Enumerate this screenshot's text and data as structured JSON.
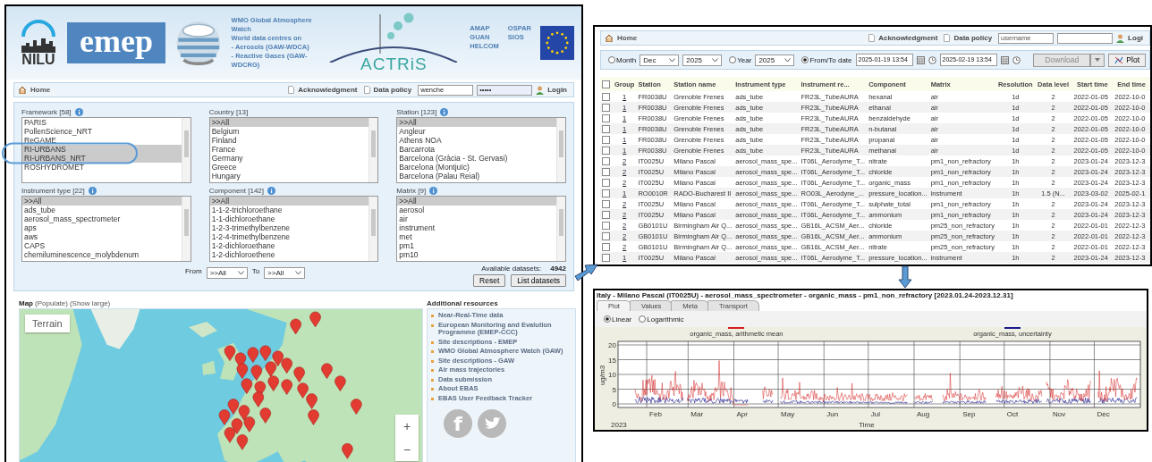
{
  "header": {
    "nilu": "NILU",
    "emep": "emep",
    "wmo_lines": [
      "WMO Global Atmosphere Watch",
      "World data centres on",
      "- Aerosols (GAW-WDCA)",
      "- Reactive Gases (GAW-WDCRG)"
    ],
    "actris": "ACTRiS",
    "partners": [
      "AMAP",
      "OSPAR",
      "GUAN",
      "SIOS",
      "HELCOM"
    ]
  },
  "search_nav": {
    "home": "Home",
    "links": [
      "Acknowledgment",
      "Data policy"
    ],
    "username": "wenche",
    "password": "•••••",
    "login": "Login"
  },
  "filters": {
    "lists": [
      {
        "label": "Framework [58]",
        "info": true,
        "items": [
          {
            "label": "PARIS",
            "selected": false
          },
          {
            "label": "PollenScience_NRT",
            "selected": false
          },
          {
            "label": "ReGAME",
            "selected": false
          },
          {
            "label": "RI-URBANS",
            "selected": true
          },
          {
            "label": "RI-URBANS_NRT",
            "selected": true
          },
          {
            "label": "ROSHYDROMET",
            "selected": false
          }
        ]
      },
      {
        "label": "Country [13]",
        "info": false,
        "items": [
          {
            "label": ">>All",
            "selected": true
          },
          {
            "label": "Belgium",
            "selected": false
          },
          {
            "label": "Finland",
            "selected": false
          },
          {
            "label": "France",
            "selected": false
          },
          {
            "label": "Germany",
            "selected": false
          },
          {
            "label": "Greece",
            "selected": false
          },
          {
            "label": "Hungary",
            "selected": false
          }
        ]
      },
      {
        "label": "Station [123]",
        "info": true,
        "items": [
          {
            "label": ">>All",
            "selected": true
          },
          {
            "label": "Angleur",
            "selected": false
          },
          {
            "label": "Athens NOA",
            "selected": false
          },
          {
            "label": "Barcarrota",
            "selected": false
          },
          {
            "label": "Barcelona (Gràcia - St. Gervasi)",
            "selected": false
          },
          {
            "label": "Barcelona (Montjuïc)",
            "selected": false
          },
          {
            "label": "Barcelona (Palau Reial)",
            "selected": false
          }
        ]
      },
      {
        "label": "Instrument type [22]",
        "info": true,
        "items": [
          {
            "label": ">>All",
            "selected": true
          },
          {
            "label": "ads_tube",
            "selected": false
          },
          {
            "label": "aerosol_mass_spectrometer",
            "selected": false
          },
          {
            "label": "aps",
            "selected": false
          },
          {
            "label": "aws",
            "selected": false
          },
          {
            "label": "CAPS",
            "selected": false
          },
          {
            "label": "chemiluminescence_molybdenum",
            "selected": false
          }
        ]
      },
      {
        "label": "Component [142]",
        "info": true,
        "items": [
          {
            "label": ">>All",
            "selected": true
          },
          {
            "label": "1-1-2-trichloroethane",
            "selected": false
          },
          {
            "label": "1-1-dichloroethane",
            "selected": false
          },
          {
            "label": "1-2-3-trimethylbenzene",
            "selected": false
          },
          {
            "label": "1-2-4-trimethylbenzene",
            "selected": false
          },
          {
            "label": "1-2-dichloroethane",
            "selected": false
          },
          {
            "label": "1-2-dichloroethene",
            "selected": false
          }
        ]
      },
      {
        "label": "Matrix [9]",
        "info": true,
        "items": [
          {
            "label": ">>All",
            "selected": true
          },
          {
            "label": "aerosol",
            "selected": false
          },
          {
            "label": "air",
            "selected": false
          },
          {
            "label": "instrument",
            "selected": false
          },
          {
            "label": "met",
            "selected": false
          },
          {
            "label": "pm1",
            "selected": false
          },
          {
            "label": "pm10",
            "selected": false
          }
        ]
      }
    ],
    "from": {
      "label": "From",
      "value": ">>All"
    },
    "to": {
      "label": "To",
      "value": ">>All"
    },
    "available_label": "Available datasets:",
    "available_count": "4942",
    "buttons": [
      "Reset",
      "List datasets"
    ]
  },
  "map": {
    "title": "Map",
    "links": [
      "(Populate)",
      "(Show large)"
    ],
    "terrain": "Terrain",
    "zoom": [
      "+",
      "−"
    ]
  },
  "resources": {
    "title": "Additional resources",
    "items": [
      "Near-Real-Time data",
      "European Monitoring and Evalution Programme (EMEP-CCC)",
      "Site descriptions - EMEP",
      "WMO Global Atmosphere Watch (GAW)",
      "Site descriptions - GAW",
      "Air mass trajectories",
      "Data submission",
      "About EBAS",
      "EBAS User Feedback Tracker"
    ],
    "facebook": "f"
  },
  "results_nav": {
    "home": "Home",
    "links": [
      "Acknowledgment",
      "Data policy"
    ],
    "username": "username",
    "login": "Logi"
  },
  "toolbar": {
    "month": {
      "label": "Month",
      "selected": false,
      "month": "Dec",
      "year": "2025"
    },
    "year": {
      "label": "Year",
      "selected": false,
      "value": "2025"
    },
    "range": {
      "label": "From/To date",
      "selected": true,
      "from": "2025-01-19 13:54",
      "to": "2025-02-19 13:54"
    },
    "download": {
      "label": "Download",
      "disabled": true
    },
    "plot": "Plot"
  },
  "table": {
    "all_checked": false,
    "columns": [
      "Group",
      "Station",
      "Station name",
      "Instrument type",
      "Instrument re...",
      "Component",
      "Matrix",
      "Resolution",
      "Data level",
      "Start time",
      "End time"
    ],
    "rows": [
      {
        "checked": false,
        "cells": [
          "1",
          "FR0038U",
          "Grenoble Frenes",
          "ads_tube",
          "FR23L_TubeAURA",
          "hexanal",
          "air",
          "1d",
          "2",
          "2022-01-05",
          "2022-10-0"
        ]
      },
      {
        "checked": false,
        "cells": [
          "1",
          "FR0038U",
          "Grenoble Frenes",
          "ads_tube",
          "FR23L_TubeAURA",
          "ethanal",
          "air",
          "1d",
          "2",
          "2022-01-05",
          "2022-10-0"
        ]
      },
      {
        "checked": false,
        "cells": [
          "1",
          "FR0038U",
          "Grenoble Frenes",
          "ads_tube",
          "FR23L_TubeAURA",
          "benzaldehyde",
          "air",
          "1d",
          "2",
          "2022-01-05",
          "2022-10-0"
        ]
      },
      {
        "checked": false,
        "cells": [
          "1",
          "FR0038U",
          "Grenoble Frenes",
          "ads_tube",
          "FR23L_TubeAURA",
          "n-butanal",
          "air",
          "1d",
          "2",
          "2022-01-05",
          "2022-10-0"
        ]
      },
      {
        "checked": false,
        "cells": [
          "1",
          "FR0038U",
          "Grenoble Frenes",
          "ads_tube",
          "FR23L_TubeAURA",
          "propanal",
          "air",
          "1d",
          "2",
          "2022-01-05",
          "2022-10-0"
        ]
      },
      {
        "checked": false,
        "cells": [
          "1",
          "FR0038U",
          "Grenoble Frenes",
          "ads_tube",
          "FR23L_TubeAURA",
          "methanal",
          "air",
          "1d",
          "2",
          "2022-01-05",
          "2022-10-0"
        ]
      },
      {
        "checked": false,
        "cells": [
          "2",
          "IT0025U",
          "Milano Pascal",
          "aerosol_mass_spe...",
          "IT06L_Aerodyme_T...",
          "nitrate",
          "pm1_non_refractory",
          "1h",
          "2",
          "2023-01-24",
          "2023-12-3"
        ]
      },
      {
        "checked": false,
        "cells": [
          "2",
          "IT0025U",
          "Milano Pascal",
          "aerosol_mass_spe...",
          "IT06L_Aerodyme_T...",
          "chloride",
          "pm1_non_refractory",
          "1h",
          "2",
          "2023-01-24",
          "2023-12-3"
        ]
      },
      {
        "checked": false,
        "cells": [
          "2",
          "IT0025U",
          "Milano Pascal",
          "aerosol_mass_spe...",
          "IT06L_Aerodyme_T...",
          "organic_mass",
          "pm1_non_refractory",
          "1h",
          "2",
          "2023-01-24",
          "2023-12-3"
        ]
      },
      {
        "checked": false,
        "cells": [
          "1",
          "RO0010R",
          "RADO-Bucharest II",
          "aerosol_mass_spe...",
          "RO03L_Aerodyne_...",
          "pressure_location...",
          "instrument",
          "1h",
          "1.5 (N...",
          "2023-03-02",
          "2025-02-1"
        ]
      },
      {
        "checked": false,
        "cells": [
          "2",
          "IT0025U",
          "Milano Pascal",
          "aerosol_mass_spe...",
          "IT06L_Aerodyme_T...",
          "sulphate_total",
          "pm1_non_refractory",
          "1h",
          "2",
          "2023-01-24",
          "2023-12-3"
        ]
      },
      {
        "checked": false,
        "cells": [
          "2",
          "IT0025U",
          "Milano Pascal",
          "aerosol_mass_spe...",
          "IT06L_Aerodyme_T...",
          "ammonium",
          "pm1_non_refractory",
          "1h",
          "2",
          "2023-01-24",
          "2023-12-3"
        ]
      },
      {
        "checked": false,
        "cells": [
          "2",
          "GB0101U",
          "Birmingham Air Q...",
          "aerosol_mass_spe...",
          "GB16L_ACSM_Aer...",
          "chloride",
          "pm25_non_refractory",
          "1h",
          "2",
          "2022-01-01",
          "2022-12-3"
        ]
      },
      {
        "checked": false,
        "cells": [
          "2",
          "GB0101U",
          "Birmingham Air Q...",
          "aerosol_mass_spe...",
          "GB16L_ACSM_Aer...",
          "ammonium",
          "pm25_non_refractory",
          "1h",
          "2",
          "2022-01-01",
          "2022-12-3"
        ]
      },
      {
        "checked": false,
        "cells": [
          "2",
          "GB0101U",
          "Birmingham Air Q...",
          "aerosol_mass_spe...",
          "GB16L_ACSM_Aer...",
          "nitrate",
          "pm25_non_refractory",
          "1h",
          "2",
          "2022-01-01",
          "2022-12-3"
        ]
      },
      {
        "checked": false,
        "cells": [
          "1",
          "IT0025U",
          "Milano Pascal",
          "aerosol_mass_spe...",
          "IT06L_Aerodyme_T...",
          "pressure_location...",
          "instrument",
          "1h",
          "2",
          "2023-01-24",
          "2023-12-3"
        ]
      }
    ]
  },
  "plot_panel": {
    "title": "Italy - Milano Pascal (IT0025U) - aerosol_mass_spectrometer - organic_mass - pm1_non_refractory [2023.01.24-2023.12.31]",
    "tabs": [
      {
        "label": "Plot",
        "selected": true
      },
      {
        "label": "Values",
        "selected": false
      },
      {
        "label": "Meta",
        "selected": false
      },
      {
        "label": "Transport",
        "selected": false
      }
    ],
    "scales": [
      {
        "label": "Linear",
        "selected": true
      },
      {
        "label": "Logarithmic",
        "selected": false
      }
    ],
    "legend": [
      {
        "label": "organic_mass, arithmetic mean",
        "color": "#d42020"
      },
      {
        "label": "organic_mass, uncertainty",
        "color": "#1a1a8c"
      }
    ],
    "y_ticks": [
      "20",
      "15",
      "10",
      "5",
      "0"
    ],
    "y_label": "ug/m3",
    "months": [
      "Feb",
      "Mar",
      "Apr",
      "May",
      "Jun",
      "Jul",
      "Aug",
      "Sep",
      "Oct",
      "Nov",
      "Dec"
    ],
    "year": "2023",
    "x_label": "Time"
  }
}
